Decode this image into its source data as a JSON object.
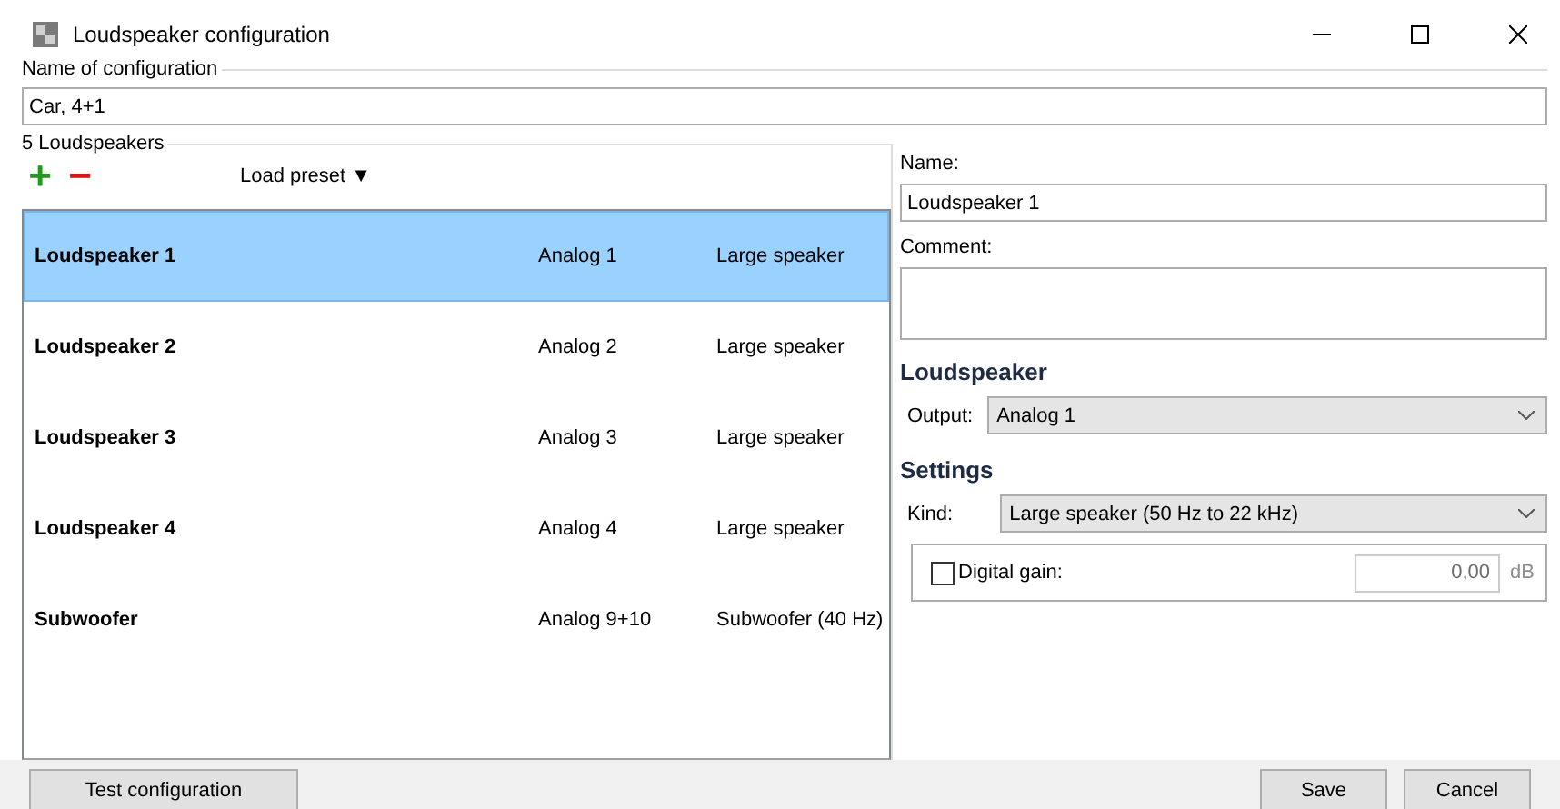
{
  "window": {
    "title": "Loudspeaker configuration"
  },
  "configuration": {
    "label": "Name of configuration",
    "value": "Car, 4+1"
  },
  "speakers": {
    "heading": "5 Loudspeakers",
    "add_label": "+",
    "remove_label": "−",
    "preset": "Load preset ▼",
    "rows": [
      {
        "name": "Loudspeaker 1",
        "output": "Analog 1",
        "type": "Large speaker",
        "selected": true
      },
      {
        "name": "Loudspeaker 2",
        "output": "Analog 2",
        "type": "Large speaker",
        "selected": false
      },
      {
        "name": "Loudspeaker 3",
        "output": "Analog 3",
        "type": "Large speaker",
        "selected": false
      },
      {
        "name": "Loudspeaker 4",
        "output": "Analog 4",
        "type": "Large speaker",
        "selected": false
      },
      {
        "name": "Subwoofer",
        "output": "Analog 9+10",
        "type": "Subwoofer (40 Hz)",
        "selected": false
      }
    ]
  },
  "details": {
    "name_label": "Name:",
    "name_value": "Loudspeaker 1",
    "comment_label": "Comment:",
    "loudspeaker_heading": "Loudspeaker",
    "output_label": "Output:",
    "output_value": "Analog 1",
    "settings_heading": "Settings",
    "kind_label": "Kind:",
    "kind_value": "Large speaker (50 Hz to 22 kHz)",
    "gain": {
      "label": "Digital gain:",
      "checked": false,
      "value": "0,00",
      "unit": "dB"
    }
  },
  "buttons": {
    "test": "Test configuration",
    "save": "Save",
    "cancel": "Cancel"
  }
}
